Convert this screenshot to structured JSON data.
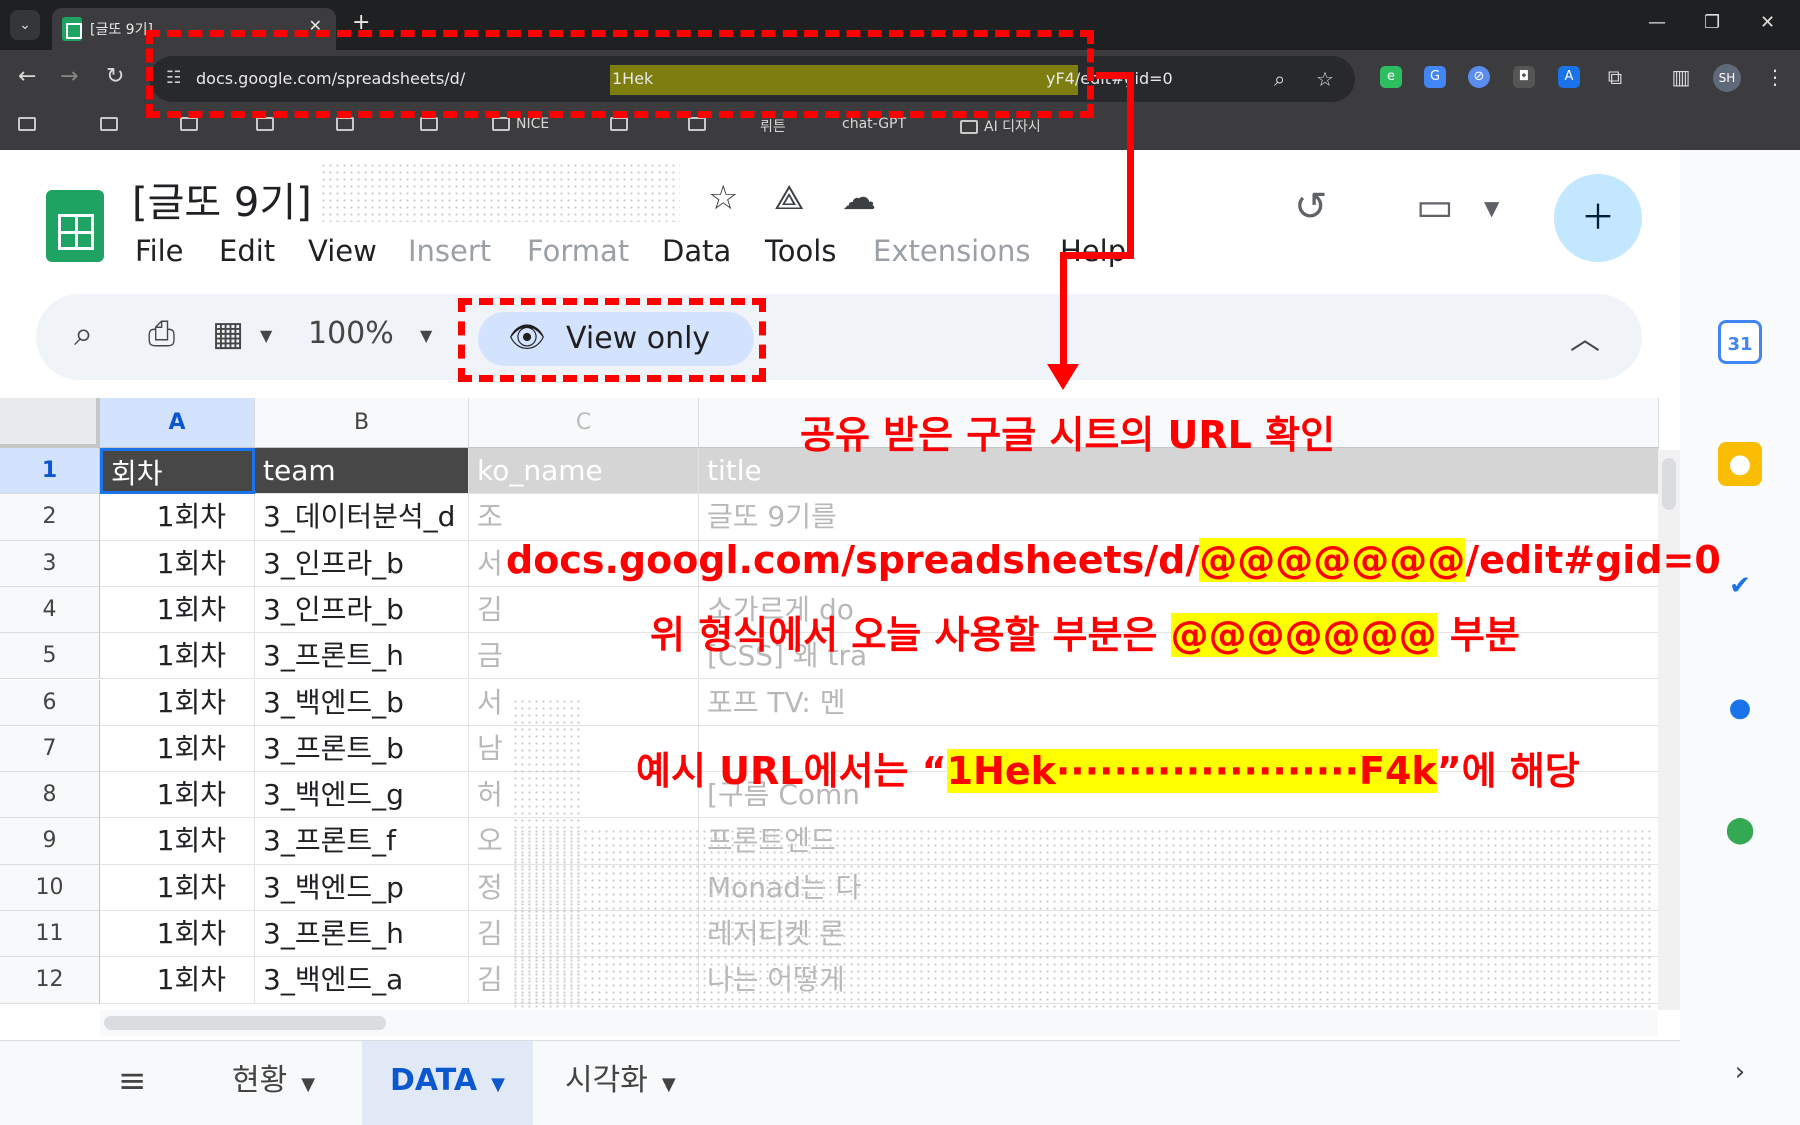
{
  "browser": {
    "tab_title": "[글또 9기]",
    "url_prefix": "docs.google.com/spreadsheets/d/",
    "url_highlight": "1Hek",
    "url_suffix": "yF4/edit#gid=0",
    "bookmarks": [
      "NICE",
      "뤼튼",
      "chat-GPT",
      "AI 디자시"
    ],
    "profile_initials": "SH"
  },
  "doc": {
    "title": "[글또 9기]",
    "menu": [
      "File",
      "Edit",
      "View",
      "Insert",
      "Format",
      "Data",
      "Tools",
      "Extensions",
      "Help"
    ]
  },
  "toolbar": {
    "zoom": "100%",
    "view_only": "View only"
  },
  "grid": {
    "columns": [
      "A",
      "B",
      "C",
      "",
      ""
    ],
    "row_numbers": [
      "1",
      "2",
      "3",
      "4",
      "5",
      "6",
      "7",
      "8",
      "9",
      "10",
      "11",
      "12"
    ],
    "header_row": [
      "회차",
      "team",
      "ko_name",
      "title"
    ],
    "rows": [
      [
        "1회차",
        "3_데이터분석_d",
        "조",
        "글또 9기를"
      ],
      [
        "1회차",
        "3_인프라_b",
        "서",
        ""
      ],
      [
        "1회차",
        "3_인프라_b",
        "김",
        "소가르게 do"
      ],
      [
        "1회차",
        "3_프론트_h",
        "금",
        "[CSS] 왜 tra"
      ],
      [
        "1회차",
        "3_백엔드_b",
        "서",
        "포프 TV: 멘"
      ],
      [
        "1회차",
        "3_프론트_b",
        "남",
        ""
      ],
      [
        "1회차",
        "3_백엔드_g",
        "허",
        "[구름 Comn"
      ],
      [
        "1회차",
        "3_프론트_f",
        "오",
        "프론트엔드"
      ],
      [
        "1회차",
        "3_백엔드_p",
        "정",
        "Monad는 다"
      ],
      [
        "1회차",
        "3_프론트_h",
        "김",
        "레저티켓 론"
      ],
      [
        "1회차",
        "3_백엔드_a",
        "김",
        "나는 어떻게"
      ]
    ]
  },
  "sheets": [
    {
      "label": "현황",
      "active": false
    },
    {
      "label": "DATA",
      "active": true
    },
    {
      "label": "시각화",
      "active": false
    }
  ],
  "annotations": {
    "title": "공유 받은 구글 시트의 URL 확인",
    "line1_a": "docs.googl.com/spreadsheets/d/",
    "line1_hl": "@@@@@@@",
    "line1_b": "/edit#gid=0",
    "line2_a": "위 형식에서 오늘 사용할 부분은 ",
    "line2_hl": "@@@@@@@",
    "line2_b": " 부분",
    "line3_a": "예시 URL에서는 “",
    "line3_hl": "1Hek·····················F4k",
    "line3_b": "”에 해당"
  },
  "colors": {
    "annotation_red": "#ff0000",
    "highlight_yellow": "#ffff00",
    "sheets_green": "#1ea362",
    "selection_blue": "#d3e3fd"
  }
}
